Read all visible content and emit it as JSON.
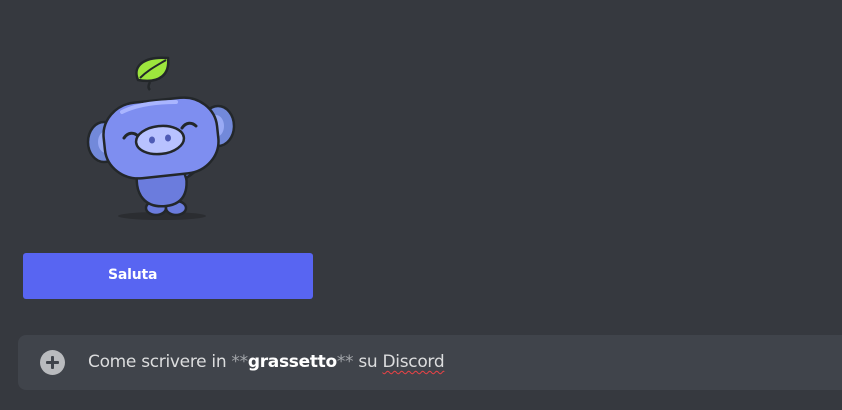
{
  "wave_prompt": {
    "button_label": "Saluta",
    "illustration": "wumpus-waving-icon"
  },
  "composer": {
    "add_icon": "plus-circle-icon",
    "message": {
      "prefix": "Come scrivere in ",
      "md_open": "**",
      "bold": "grassetto",
      "md_close": "**",
      "middle": " su ",
      "misspelled": "Discord"
    }
  },
  "colors": {
    "background": "#36393f",
    "composer": "#40444b",
    "button": "#5865f2",
    "spellcheck": "#ed4245"
  }
}
